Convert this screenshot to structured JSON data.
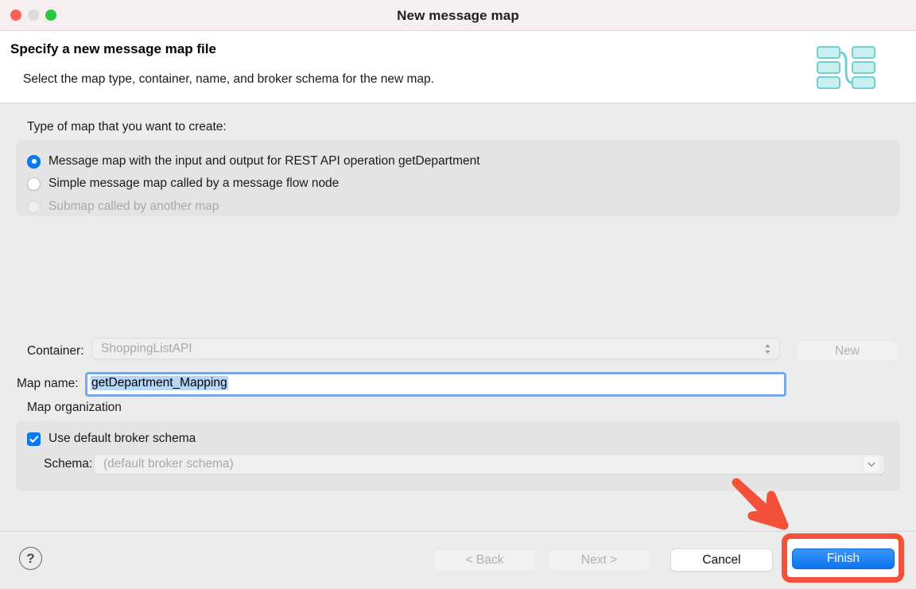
{
  "window": {
    "title": "New message map",
    "traffic_lights": [
      "close-button",
      "minimize-button",
      "zoom-button"
    ]
  },
  "header": {
    "title": "Specify a new message map file",
    "subtitle": "Select the map type, container, name, and broker schema for the new map.",
    "icon": "message-map-icon"
  },
  "map_type": {
    "legend": "Type of map that you want to create:",
    "options": [
      {
        "label": "Message map with the input and output for REST API operation getDepartment",
        "selected": true,
        "disabled": false
      },
      {
        "label": "Simple message map called by a message flow node",
        "selected": false,
        "disabled": false
      },
      {
        "label": "Submap called by another map",
        "selected": false,
        "disabled": true
      }
    ]
  },
  "container_row": {
    "label": "Container:",
    "value": "ShoppingListAPI",
    "disabled": true,
    "new_button": "New"
  },
  "map_name_row": {
    "label": "Map name:",
    "value": "getDepartment_Mapping",
    "selected": true
  },
  "map_organization": {
    "legend": "Map organization",
    "checkbox_label": "Use default broker schema",
    "checked": true,
    "schema_label": "Schema:",
    "schema_value": "(default broker schema)",
    "schema_disabled": true
  },
  "footer": {
    "help": "?",
    "back": "< Back",
    "next": "Next >",
    "cancel": "Cancel",
    "finish": "Finish"
  },
  "annotation": {
    "arrow": "red-arrow-pointing-to-finish",
    "highlight_target": "Finish"
  },
  "colors": {
    "accent_blue": "#067cf6",
    "annotation_red": "#f4513a",
    "window_bg": "#ececec",
    "group_bg": "#e4e4e4",
    "header_bg": "#ffffff",
    "titlebar_bg": "#f5f0ef",
    "icon_teal": "#7ececf"
  }
}
